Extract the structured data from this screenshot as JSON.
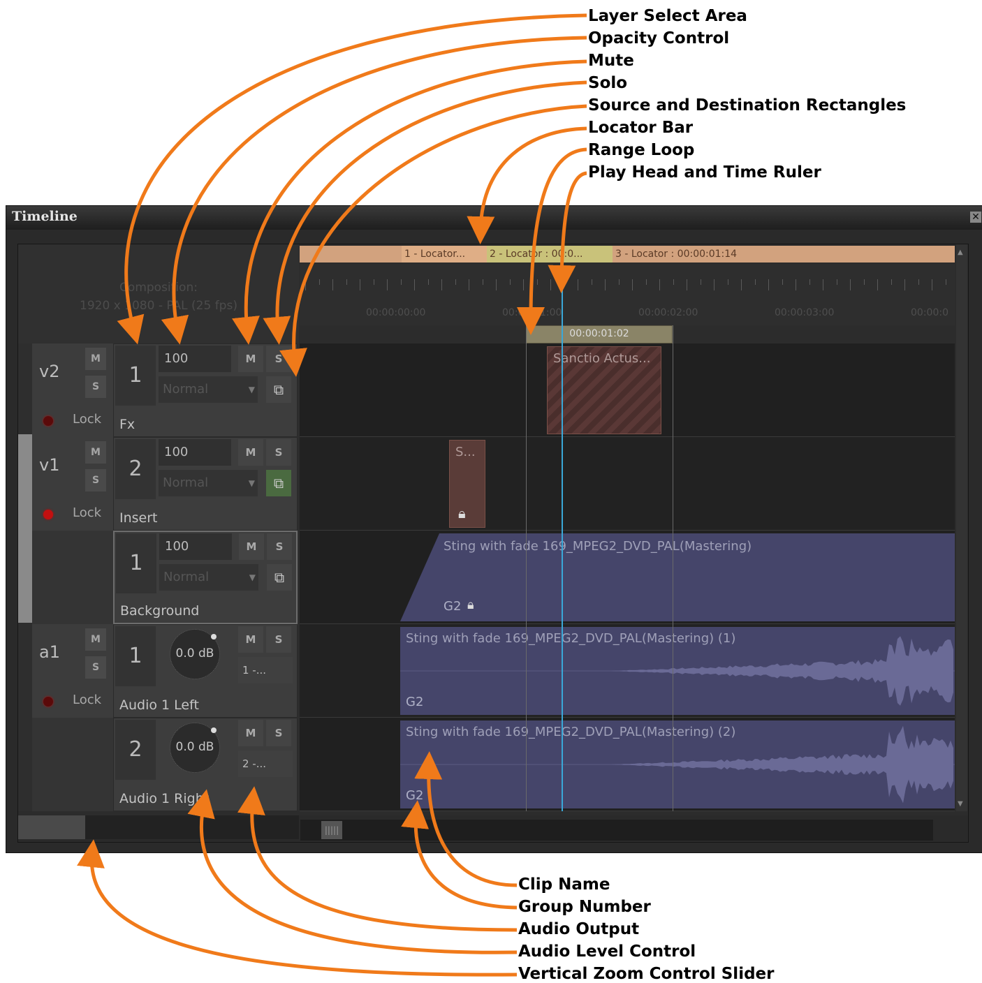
{
  "window": {
    "title": "Timeline",
    "close_glyph": "✕"
  },
  "composition": {
    "line1": "Composition:",
    "line2": "1920 x 1080 - PAL (25 fps)"
  },
  "locators": [
    "1 - Locator...",
    "2 - Locator : 00:0...",
    "3 - Locator : 00:00:01:14"
  ],
  "ruler": {
    "labels": [
      "00:00:00:00",
      "00:00:01:00",
      "00:00:02:00",
      "00:00:03:00",
      "00:00:0"
    ]
  },
  "range": {
    "label": "00:00:01:02"
  },
  "groups": [
    {
      "name": "v2",
      "m": "M",
      "s": "S",
      "lock": "Lock"
    },
    {
      "name": "v1",
      "m": "M",
      "s": "S",
      "lock": "Lock"
    },
    {
      "name": "a1",
      "m": "M",
      "s": "S",
      "lock": "Lock"
    }
  ],
  "layers": [
    {
      "num": "1",
      "opacity": "100",
      "blend": "Normal",
      "m": "M",
      "s": "S",
      "name": "Fx",
      "rect_icon": "rect-icon"
    },
    {
      "num": "2",
      "opacity": "100",
      "blend": "Normal",
      "m": "M",
      "s": "S",
      "name": "Insert",
      "rect_icon": "rect-icon"
    },
    {
      "num": "1",
      "opacity": "100",
      "blend": "Normal",
      "m": "M",
      "s": "S",
      "name": "Background",
      "rect_icon": "rect-icon"
    },
    {
      "num": "1",
      "level": "0.0 dB",
      "m": "M",
      "s": "S",
      "output": "1 -...",
      "name": "Audio 1 Left"
    },
    {
      "num": "2",
      "level": "0.0 dB",
      "m": "M",
      "s": "S",
      "output": "2 -...",
      "name": "Audio 1 Right"
    }
  ],
  "clips": [
    {
      "name": "Sanctio Actus..."
    },
    {
      "name": "S...",
      "icon": "lock-icon"
    },
    {
      "name": "Sting with fade 169_MPEG2_DVD_PAL(Mastering)",
      "group": "G2",
      "icon": "lock-icon"
    },
    {
      "name": "Sting with fade 169_MPEG2_DVD_PAL(Mastering) (1)",
      "group": "G2"
    },
    {
      "name": "Sting with fade 169_MPEG2_DVD_PAL(Mastering) (2)",
      "group": "G2"
    }
  ],
  "callouts": {
    "top": [
      "Layer Select Area",
      "Opacity Control",
      "Mute",
      "Solo",
      "Source and Destination Rectangles",
      "Locator Bar",
      "Range Loop",
      "Play Head and Time Ruler"
    ],
    "bottom": [
      "Clip Name",
      "Group Number",
      "Audio Output",
      "Audio Level Control",
      "Vertical Zoom Control Slider"
    ]
  },
  "colors": {
    "arrow": "#f07a1a",
    "locator": "#d2a27e",
    "clip_video": "#45456a",
    "clip_fx": "#5a3a38",
    "playhead": "#3aa8d8"
  }
}
